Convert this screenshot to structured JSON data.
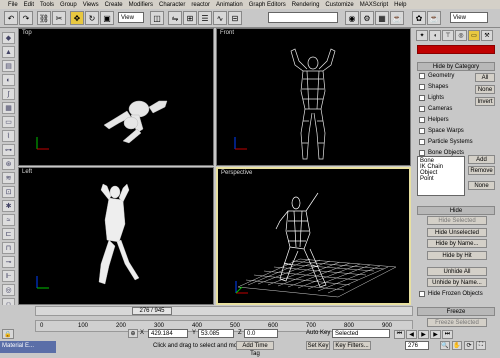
{
  "menu": [
    "File",
    "Edit",
    "Tools",
    "Group",
    "Views",
    "Create",
    "Modifiers",
    "Character",
    "reactor",
    "Animation",
    "Graph Editors",
    "Rendering",
    "Customize",
    "MAXScript",
    "Help"
  ],
  "toolbar": {
    "view_select": "View",
    "view_select2": "View"
  },
  "viewports": {
    "top": "Top",
    "front": "Front",
    "left": "Left",
    "perspective": "Perspective"
  },
  "timeslider": {
    "label": "276 / 945"
  },
  "ruler_labels": [
    "0",
    "100",
    "200",
    "300",
    "400",
    "500",
    "600",
    "700",
    "800",
    "900"
  ],
  "command_panel": {
    "hide_by_category": "Hide by Category",
    "categories": [
      "Geometry",
      "Shapes",
      "Lights",
      "Cameras",
      "Helpers",
      "Space Warps",
      "Particle Systems",
      "Bone Objects"
    ],
    "cat_buttons": [
      "All",
      "None",
      "Invert"
    ],
    "list_items": [
      "Bone",
      "IK Chain Object",
      "Point"
    ],
    "list_buttons": [
      "Add",
      "Remove",
      "None"
    ],
    "hide_rollout": "Hide",
    "hide_buttons": [
      "Hide Selected",
      "Hide Unselected",
      "Hide by Name...",
      "Hide by Hit",
      "Unhide All",
      "Unhide by Name..."
    ],
    "hide_frozen": "Hide Frozen Objects",
    "freeze_rollout": "Freeze",
    "freeze_selected": "Freeze Selected"
  },
  "coords": {
    "x": "429.184",
    "y": "53.085",
    "z": "0.0"
  },
  "status": {
    "auto_key": "Auto Key",
    "selected": "Selected",
    "set_key": "Set Key",
    "key_filters": "Key Filters...",
    "prompt": "Click and drag to select and move",
    "add_time_tag": "Add Time Tag",
    "frame": "276",
    "taskbar": "Material E..."
  },
  "colors": {
    "viewport_bg": "#000000",
    "active_border": "#e8e0a0",
    "ui_gray": "#c8c8c8"
  }
}
